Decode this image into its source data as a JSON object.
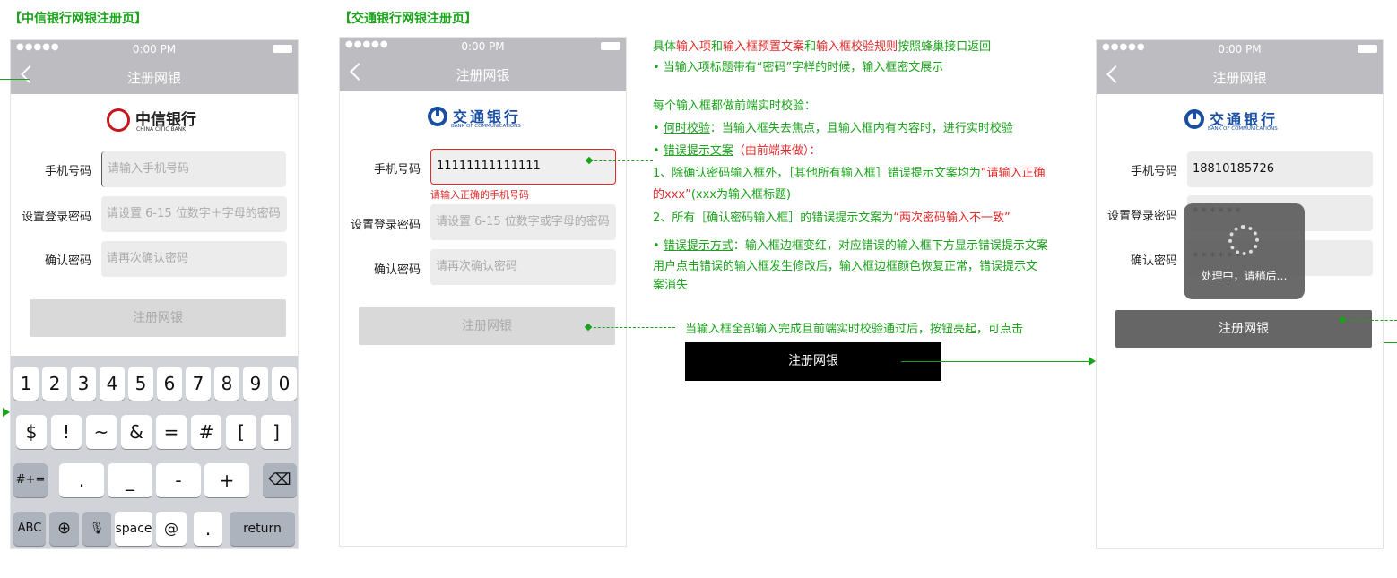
{
  "left": {
    "section_title": "【中信银行网银注册页】",
    "status": {
      "signal": "●●●●●",
      "time": "0:00 PM"
    },
    "nav_title": "注册网银",
    "logo": {
      "cn": "中信银行",
      "en": "CHINA CITIC BANK"
    },
    "fields": [
      {
        "label": "手机号码",
        "placeholder": "请输入手机号码"
      },
      {
        "label": "设置登录密码",
        "placeholder": "请设置 6-15 位数字＋字母的密码"
      },
      {
        "label": "确认密码",
        "placeholder": "请再次确认密码"
      }
    ],
    "submit": "注册网银",
    "keyboard": {
      "row1": [
        "1",
        "2",
        "3",
        "4",
        "5",
        "6",
        "7",
        "8",
        "9",
        "0"
      ],
      "row2": [
        "$",
        "!",
        "~",
        "&",
        "=",
        "#",
        "[",
        "]"
      ],
      "row3_left": "#+=",
      "row3": [
        ".",
        "_",
        "-",
        "+"
      ],
      "row3_right": "⌫",
      "row4": {
        "abc": "ABC",
        "globe": "⊕",
        "mic": "🎙",
        "space": "space",
        "at": "@",
        "dot": ".",
        "ret": "return"
      }
    }
  },
  "middle": {
    "section_title": "【交通银行网银注册页】",
    "status": {
      "signal": "●●●●●",
      "time": "0:00 PM"
    },
    "nav_title": "注册网银",
    "logo": {
      "cn": "交通银行",
      "en": "BANK OF COMMUNICATIONS"
    },
    "fields": [
      {
        "label": "手机号码",
        "value": "11111111111111",
        "error": "请输入正确的手机号码"
      },
      {
        "label": "设置登录密码",
        "placeholder": "请设置 6-15 位数字或字母的密码"
      },
      {
        "label": "确认密码",
        "placeholder": "请再次确认密码"
      }
    ],
    "submit": "注册网银"
  },
  "annotations": {
    "line1": {
      "a": "具体",
      "b": "输入项",
      "c": "和",
      "d": "输入框预置文案",
      "e": "和",
      "f": "输入框校验规则",
      "g": "按照蜂巢接口返回"
    },
    "line2": "• 当输入项标题带有“密码”字样的时候，输入框密文展示",
    "line3": "每个输入框都做前端实时校验：",
    "line4": {
      "bullet": "• ",
      "key": "何时校验",
      "rest": "：当输入框失去焦点，且输入框内有内容时，进行实时校验"
    },
    "line5": {
      "bullet": "• ",
      "key": "错误提示文案",
      "rest": "（由前端来做）："
    },
    "line6": {
      "a": "1、除确认密码输入框外，［其他所有输入框］错误提示文案均为",
      "b": "“请输入正确"
    },
    "line7": {
      "a": "的xxx”",
      "b": "(xxx为输入框标题)"
    },
    "line8": {
      "a": "2、所有［确认密码输入框］的错误提示文案为",
      "b": "“两次密码输入不一致”"
    },
    "line9": {
      "bullet": "• ",
      "key": "错误提示方式",
      "rest": "：输入框边框变红，对应错误的输入框下方显示错误提示文案"
    },
    "line10": "用户点击错误的输入框发生修改后，输入框边框颜色恢复正常，错误提示文",
    "line11": "案消失",
    "line12": "当输入框全部输入完成且前端实时校验通过后，按钮亮起，可点击",
    "black_button": "注册网银"
  },
  "right": {
    "status": {
      "signal": "●●●●●",
      "time": "0:00 PM"
    },
    "nav_title": "注册网银",
    "logo": {
      "cn": "交通银行",
      "en": "BANK OF COMMUNICATIONS"
    },
    "fields": [
      {
        "label": "手机号码",
        "value": "18810185726"
      },
      {
        "label": "设置登录密码",
        "value": "******"
      },
      {
        "label": "确认密码",
        "value": "******"
      }
    ],
    "loading_text": "处理中，请稍后…",
    "submit": "注册网银"
  },
  "colors": {
    "annotation": "#19a21a",
    "error": "#e02a2a",
    "citic": "#c8161d",
    "bocom": "#1a4ea0"
  }
}
